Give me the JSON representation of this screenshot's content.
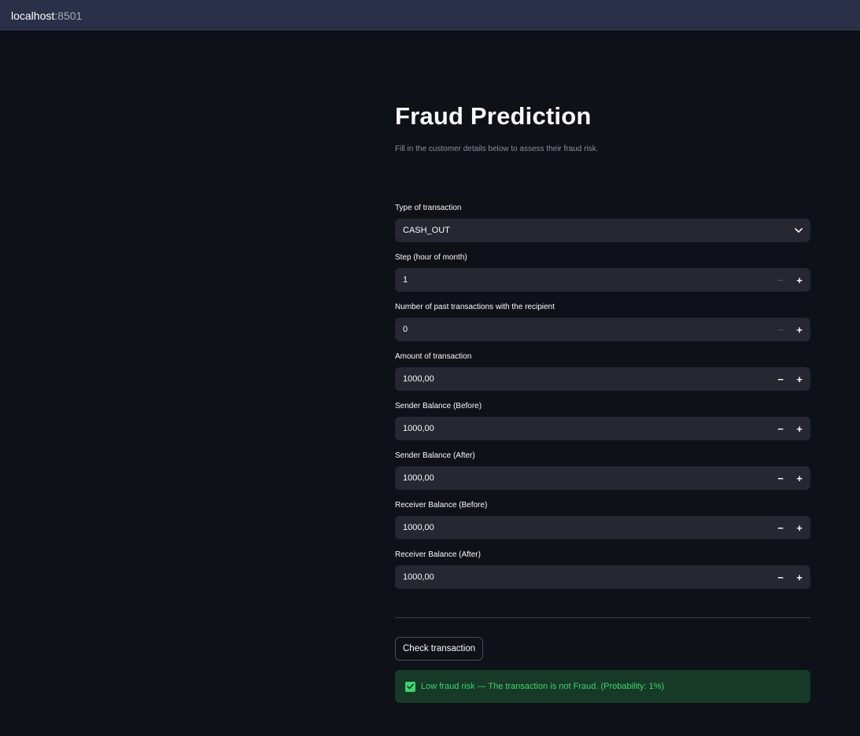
{
  "browser": {
    "host": "localhost",
    "port": ":8501"
  },
  "page": {
    "title": "Fraud Prediction",
    "subtitle": "Fill in the customer details below to assess their fraud risk."
  },
  "form": {
    "type": {
      "label": "Type of transaction",
      "value": "CASH_OUT"
    },
    "step": {
      "label": "Step (hour of month)",
      "value": "1"
    },
    "past_transactions": {
      "label": "Number of past transactions with the recipient",
      "value": "0"
    },
    "amount": {
      "label": "Amount of transaction",
      "value": "1000,00"
    },
    "sender_before": {
      "label": "Sender Balance (Before)",
      "value": "1000,00"
    },
    "sender_after": {
      "label": "Sender Balance (After)",
      "value": "1000,00"
    },
    "receiver_before": {
      "label": "Receiver Balance (Before)",
      "value": "1000,00"
    },
    "receiver_after": {
      "label": "Receiver Balance (After)",
      "value": "1000,00"
    },
    "minus_symbol": "−",
    "plus_symbol": "+"
  },
  "actions": {
    "check_label": "Check transaction"
  },
  "result": {
    "icon": "check-icon",
    "message": "Low fraud risk — The transaction is not Fraud. (Probability: 1%)"
  },
  "colors": {
    "background": "#0e1117",
    "topbar": "#293047",
    "input_bg": "#262730",
    "success_bg": "#173928",
    "success_text": "#3dd56d"
  }
}
